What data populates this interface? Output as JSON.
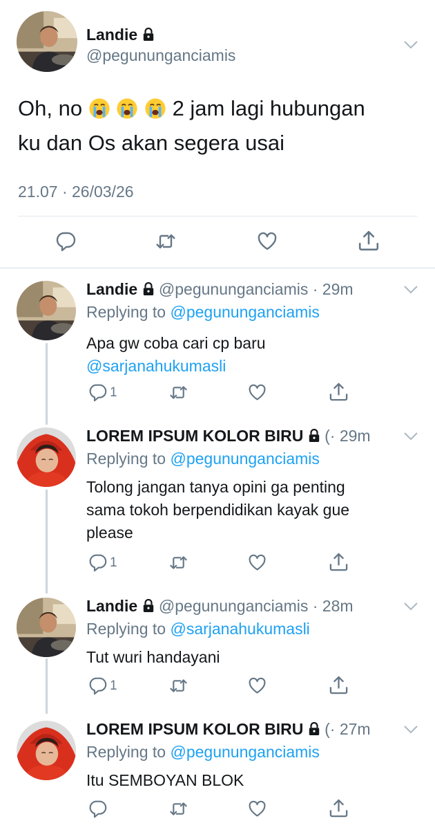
{
  "main_tweet": {
    "name": "Landie",
    "handle": "@pegununganciamis",
    "text_part1": "Oh, no",
    "emojis": [
      "😭",
      "😭",
      "😭"
    ],
    "text_part2": "2 jam lagi hubungan",
    "text_line2": "ku dan Os akan segera usai",
    "timestamp": "21.07 · 26/03/26",
    "actions": [
      "reply-icon",
      "retweet-icon",
      "like-icon",
      "share-icon"
    ]
  },
  "replies": [
    {
      "name": "Landie",
      "meta": "@pegununganciamis · 29m",
      "replying_prefix": "Replying to",
      "replying_to": "@pegununganciamis",
      "text_line1": "Apa gw coba cari cp baru",
      "text_mention": "@sarjanahukumasli",
      "reply_count": "1"
    },
    {
      "name": "LOREM IPSUM KOLOR BIRU",
      "meta": "(· 29m",
      "replying_prefix": "Replying to",
      "replying_to": "@pegununganciamis",
      "text_lines": [
        "Tolong jangan tanya opini ga penting",
        "sama tokoh berpendidikan kayak gue",
        "please"
      ],
      "reply_count": "1"
    },
    {
      "name": "Landie",
      "meta": "@pegununganciamis · 28m",
      "replying_prefix": "Replying to",
      "replying_to": "@sarjanahukumasli",
      "text_line1": "Tut wuri handayani",
      "reply_count": "1"
    },
    {
      "name": "LOREM IPSUM KOLOR BIRU",
      "meta": "(· 27m",
      "replying_prefix": "Replying to",
      "replying_to": "@pegununganciamis",
      "text_line1": "Itu SEMBOYAN BLOK",
      "reply_count": ""
    }
  ],
  "colors": {
    "text": "#14171a",
    "secondary": "#657786",
    "link": "#1da1f2",
    "divider": "#e1e8ed",
    "thread": "#ccd6dd"
  }
}
